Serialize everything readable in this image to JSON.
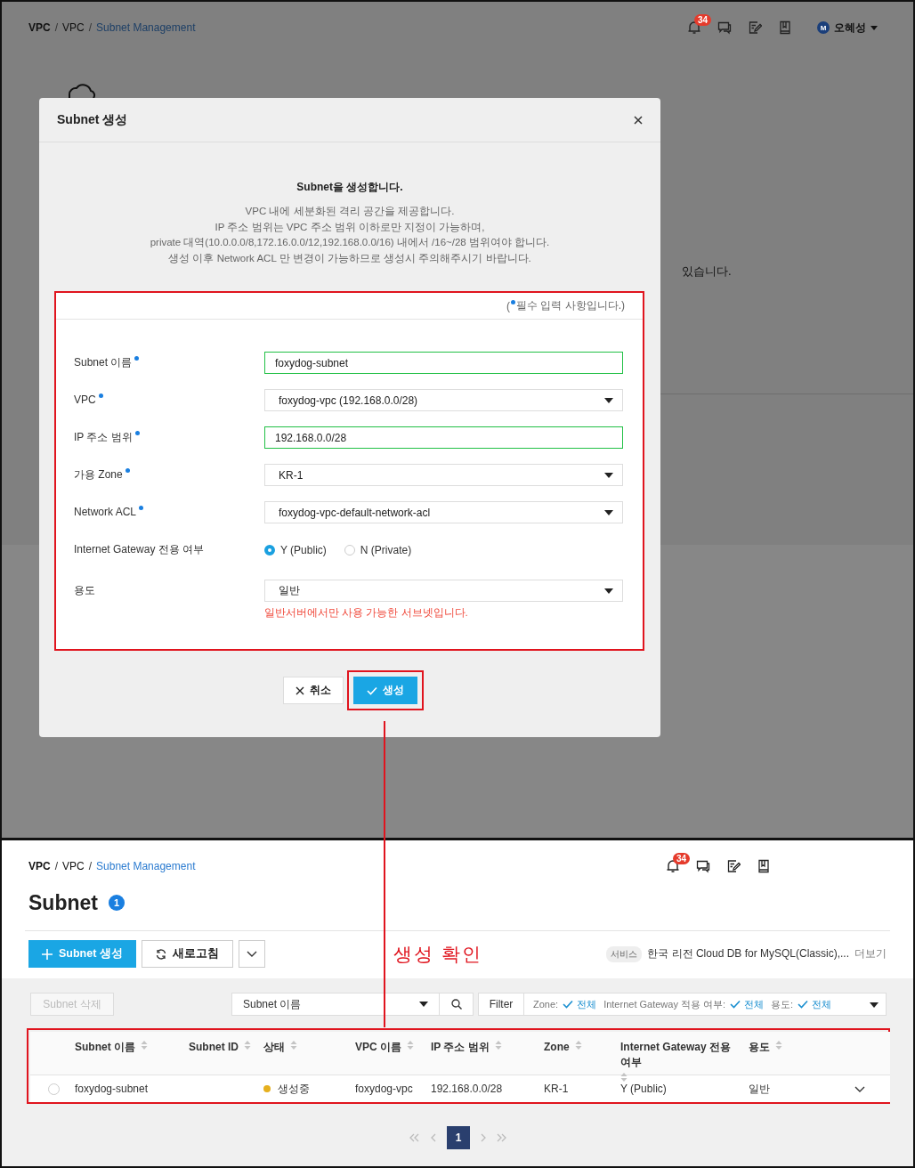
{
  "top_screen": {
    "breadcrumb": {
      "separator": "/",
      "items": [
        {
          "label": "VPC",
          "kind": "root"
        },
        {
          "label": "VPC",
          "kind": "link"
        },
        {
          "label": "Subnet Management",
          "kind": "current"
        }
      ]
    },
    "notification_count": "34",
    "user": {
      "initial": "M",
      "name": "오혜성"
    },
    "background_text": "있습니다.",
    "dialog": {
      "title": "Subnet 생성",
      "intro_title": "Subnet을 생성합니다.",
      "intro_lines": [
        "VPC 내에 세분화된 격리 공간을 제공합니다.",
        "IP 주소 범위는 VPC 주소 범위 이하로만 지정이 가능하며,",
        "private 대역(10.0.0.0/8,172.16.0.0/12,192.168.0.0/16) 내에서 /16~/28 범위여야 합니다.",
        "생성 이후 Network ACL 만 변경이 가능하므로 생성시 주의해주시기 바랍니다."
      ],
      "required_note": {
        "before": "(",
        "text": "필수 입력 사항입니다.)"
      },
      "fields": [
        {
          "kind": "text",
          "label": "Subnet 이름",
          "required": true,
          "valid": true,
          "value": "foxydog-subnet"
        },
        {
          "kind": "select",
          "label": "VPC",
          "required": true,
          "value": "foxydog-vpc (192.168.0.0/28)"
        },
        {
          "kind": "text",
          "label": "IP 주소 범위",
          "required": true,
          "valid": true,
          "value": "192.168.0.0/28"
        },
        {
          "kind": "select",
          "label": "가용 Zone",
          "required": true,
          "value": "KR-1"
        },
        {
          "kind": "select",
          "label": "Network ACL",
          "required": true,
          "value": "foxydog-vpc-default-network-acl"
        },
        {
          "kind": "radio",
          "label": "Internet Gateway 전용 여부",
          "required": false,
          "options": [
            {
              "label": "Y (Public)",
              "selected": true
            },
            {
              "label": "N (Private)",
              "selected": false
            }
          ]
        },
        {
          "kind": "select",
          "label": "용도",
          "required": false,
          "value": "일반",
          "hint": "일반서버에서만 사용 가능한 서브넷입니다."
        }
      ],
      "buttons": [
        {
          "kind": "cancel",
          "label": "취소"
        },
        {
          "kind": "primary",
          "label": "생성",
          "highlighted": true
        }
      ]
    }
  },
  "annotation": {
    "note": "생성 확인"
  },
  "bottom_screen": {
    "breadcrumb": {
      "separator": "/",
      "items": [
        {
          "label": "VPC",
          "kind": "root"
        },
        {
          "label": "VPC",
          "kind": "link"
        },
        {
          "label": "Subnet Management",
          "kind": "current"
        }
      ]
    },
    "notification_count": "34",
    "title": "Subnet",
    "count": "1",
    "toolbar": [
      {
        "kind": "create",
        "label": "Subnet 생성"
      },
      {
        "kind": "refresh",
        "label": "새로고침"
      },
      {
        "kind": "more"
      }
    ],
    "service": {
      "tag": "서비스",
      "text": "한국 리전 Cloud DB for MySQL(Classic),...",
      "link": "더보기"
    },
    "delete_button": {
      "label": "Subnet 삭제",
      "disabled": true
    },
    "search": {
      "field": "Subnet 이름"
    },
    "filter": {
      "label": "Filter",
      "items": [
        {
          "name": "Zone:",
          "value": "전체"
        },
        {
          "name": "Internet Gateway 적용 여부:",
          "value": "전체"
        },
        {
          "name": "용도:",
          "value": "전체"
        }
      ]
    },
    "table": {
      "columns": [
        {
          "label": "Subnet 이름"
        },
        {
          "label": "Subnet ID"
        },
        {
          "label": "상태"
        },
        {
          "label": "VPC 이름"
        },
        {
          "label": "IP 주소 범위"
        },
        {
          "label": "Zone"
        },
        {
          "label": "Internet Gateway 전용 여부"
        },
        {
          "label": "용도"
        }
      ],
      "rows": [
        {
          "selected": false,
          "subnet_name": "foxydog-subnet",
          "status": {
            "label": "생성중",
            "color": "#e6b01e"
          },
          "vpc_name": "foxydog-vpc",
          "ip_range": "192.168.0.0/28",
          "zone": "KR-1",
          "internet_gateway": "Y (Public)",
          "usage": "일반"
        }
      ]
    },
    "pagination": {
      "pages": [
        {
          "label": "1",
          "selected": true
        }
      ]
    }
  }
}
